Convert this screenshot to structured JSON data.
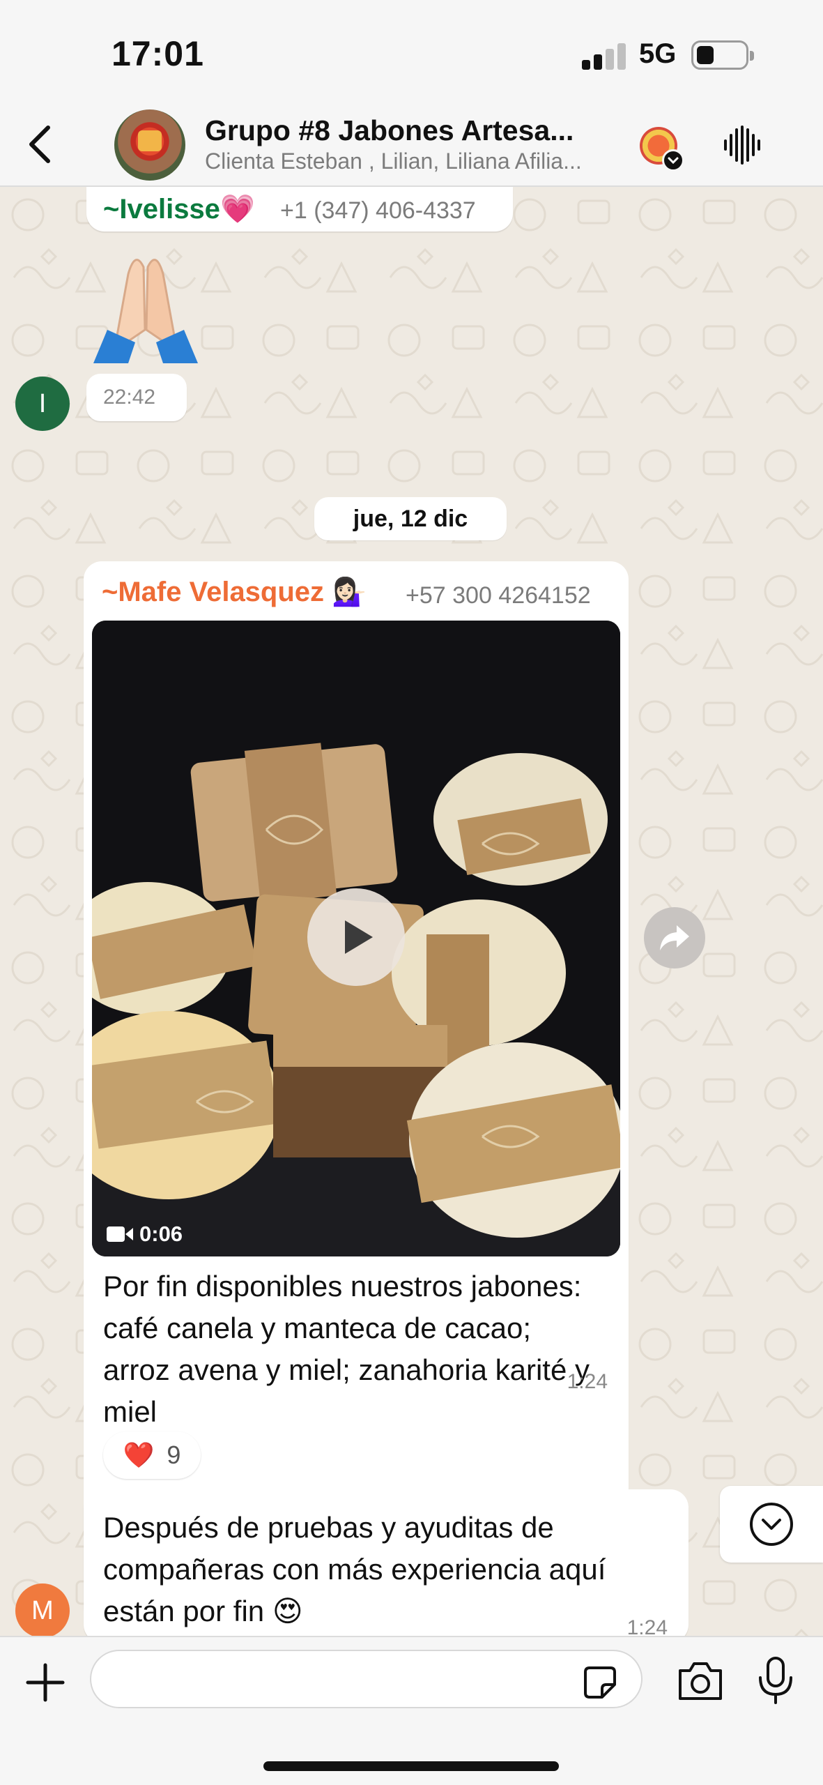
{
  "status_bar": {
    "time": "17:01",
    "network": "5G",
    "signal_bars_filled": 2,
    "battery_level": 0.3
  },
  "header": {
    "title": "Grupo #8 Jabones Artesa...",
    "subtitle": "Clienta Esteban , Lilian, Liliana Afilia...",
    "icons": {
      "back": "chevron-left-icon",
      "meta_ai": "meta-ai-icon",
      "voice_call": "waveform-icon"
    }
  },
  "messages": [
    {
      "sender": "~Ivelisse",
      "sender_emoji": "💗",
      "phone": "+1 (347) 406-4337",
      "emoji": "🙏🏻",
      "time": "22:42",
      "avatar_letter": "I",
      "name_color": "#0b7a3e"
    },
    {
      "sender": "~Mafe Velasquez",
      "sender_emoji": "💁🏻‍♀️",
      "phone": "+57 300 4264152",
      "video_duration": "0:06",
      "text": "Por fin disponibles nuestros jabones: café canela y manteca de cacao; arroz avena y miel; zanahoria karité y miel",
      "time": "1:24",
      "reaction_emoji": "❤️",
      "reaction_count": "9",
      "name_color": "#ee6c36"
    },
    {
      "text": "Después de pruebas y ayuditas de compañeras con más experiencia aquí están por fin",
      "trailing_emoji": "😍",
      "time": "1:24",
      "avatar_letter": "M"
    }
  ],
  "date_separator": "jue, 12 dic",
  "input": {
    "placeholder": "",
    "value": ""
  },
  "colors": {
    "chat_background": "#efeae2",
    "bar_background": "#f6f6f6",
    "accent_green": "#1f6c41",
    "accent_orange": "#f07a3e"
  }
}
